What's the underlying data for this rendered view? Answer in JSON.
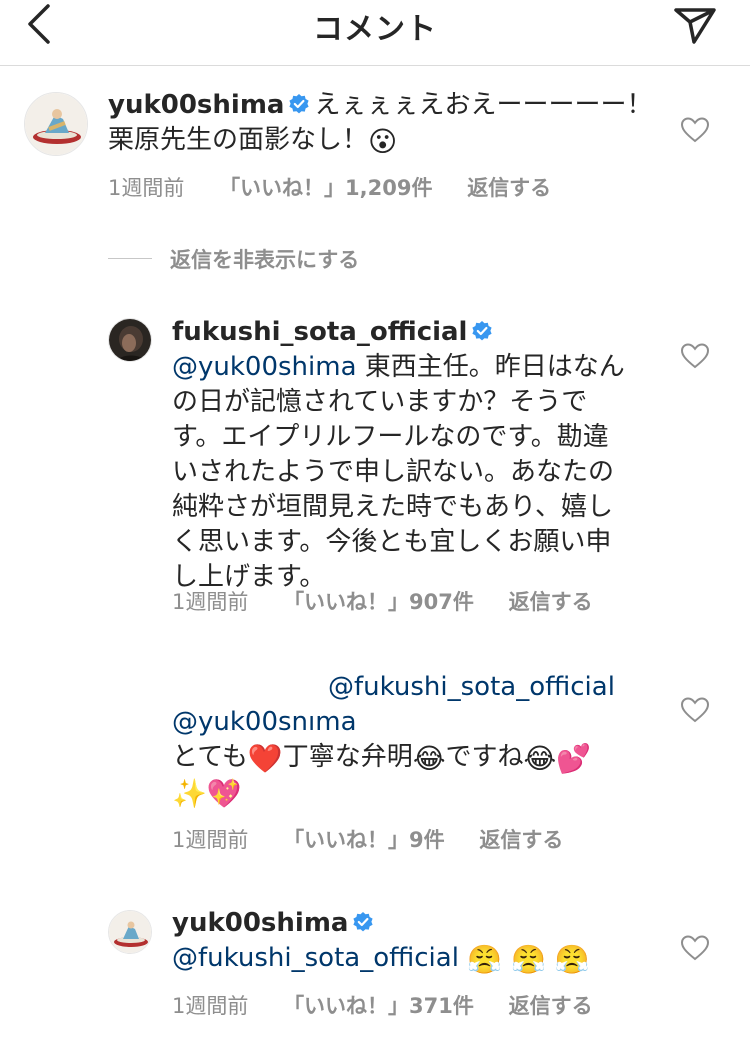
{
  "header": {
    "title": "コメント",
    "back_icon": "chevron-left-icon",
    "share_icon": "paper-plane-icon"
  },
  "comments": [
    {
      "username": "yuk00shima",
      "text": "えぇぇぇえおえーーーーー！",
      "text2": "栗原先生の面影なし！",
      "emoji": "😮",
      "time": "1週間前",
      "likes": "「いいね！」1,209件",
      "reply": "返信する"
    }
  ],
  "hide_replies": "返信を非表示にする",
  "replies": [
    {
      "username": "fukushi_sota_official",
      "mention": "@yuk00shima",
      "lines": [
        "東西主任。昨日はなん",
        "の日が記憶されていますか？そうで",
        "す。エイプリルフールなのです。勘違",
        "いされたようで申し訳ない。あなたの",
        "純粋さが垣間見えた時でもあり、嬉し",
        "く思います。今後とも宜しくお願い申",
        "し上げます。"
      ],
      "time": "1週間前",
      "likes": "「いいね！」907件",
      "reply": "返信する"
    },
    {
      "mention": "@fukushi_sota_official",
      "mention2": "@yuk00snıma",
      "text_a": "とても",
      "emoji_a": "❤️",
      "text_b": "丁寧な弁明",
      "emoji_b": "😂",
      "text_c": "ですね",
      "emoji_c": "😂",
      "emoji_d": "💕",
      "emoji_e": "✨",
      "emoji_f": "💖",
      "time": "1週間前",
      "likes": "「いいね！」9件",
      "reply": "返信する"
    },
    {
      "username": "yuk00shima",
      "mention": "@fukushi_sota_official",
      "emojis": "😤 😤 😤",
      "time": "1週間前",
      "likes": "「いいね！」371件",
      "reply": "返信する"
    }
  ]
}
